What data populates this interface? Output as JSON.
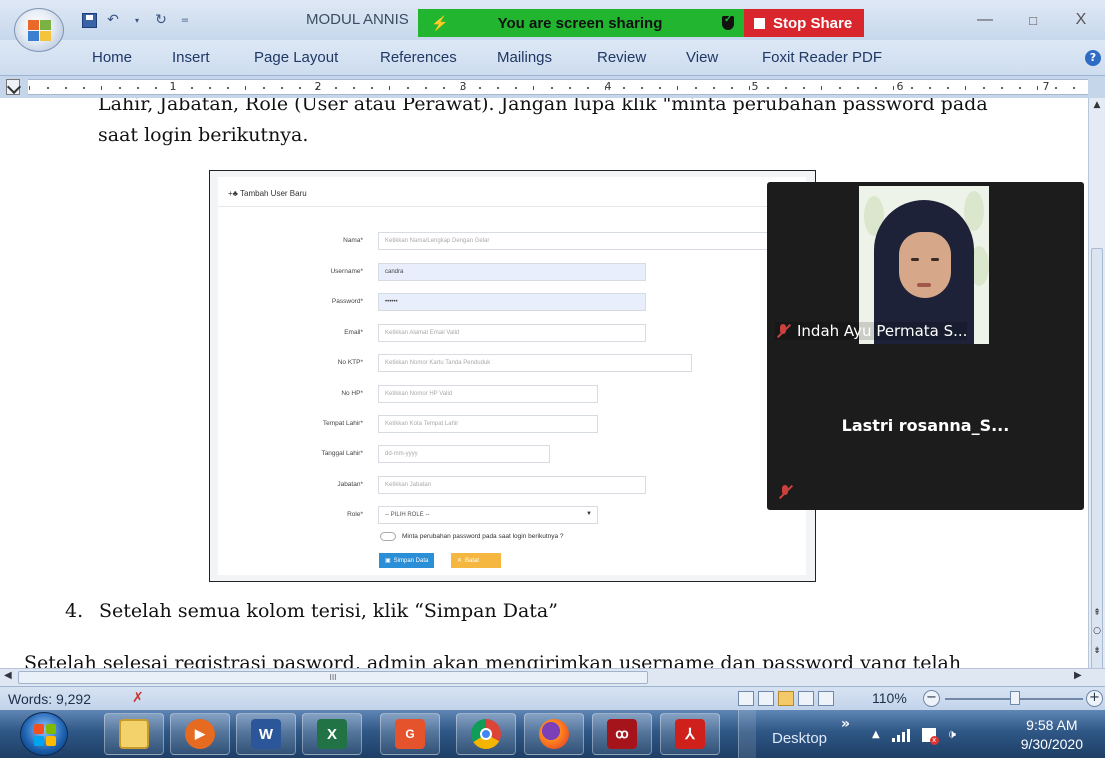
{
  "window": {
    "doc_title": "MODUL ANNIS",
    "min_symbol": "—",
    "max_symbol": "□",
    "close_symbol": "X"
  },
  "share": {
    "banner_text": "You are screen sharing",
    "stop_label": "Stop Share",
    "banner_color": "#22b630",
    "stop_color": "#d8262c"
  },
  "ribbon": {
    "tabs": [
      "Home",
      "Insert",
      "Page Layout",
      "References",
      "Mailings",
      "Review",
      "View",
      "Foxit Reader PDF"
    ]
  },
  "ruler": {
    "labels": [
      "1",
      "2",
      "3",
      "4",
      "5",
      "6",
      "7"
    ]
  },
  "document": {
    "line_top": "Lahir, Jabatan, Role (User atau Perawat). Jangan lupa klik \"minta perubahan password pada",
    "line_2": "saat login berikutnya.",
    "step_number": "4.",
    "step_text": "Setelah semua kolom terisi, klik “Simpan Data”",
    "line_bottom": "Setelah selesai registrasi pasword, admin akan mengirimkan username dan password yang telah"
  },
  "form_screenshot": {
    "header": "+♣ Tambah User Baru",
    "fields": [
      {
        "label": "Nama*",
        "value": "Ketikkan Nama/Lengkap Dengan Gelar",
        "filled": false
      },
      {
        "label": "Username*",
        "value": "candra",
        "filled": true
      },
      {
        "label": "Password*",
        "value": "••••••",
        "filled": true
      },
      {
        "label": "Email*",
        "value": "Ketikkan Alamat Email Valid",
        "filled": false
      },
      {
        "label": "No KTP*",
        "value": "Ketikkan Nomor Kartu Tanda Penduduk",
        "filled": false
      },
      {
        "label": "No HP*",
        "value": "Ketikkan Nomor HP Valid",
        "filled": false
      },
      {
        "label": "Tempat Lahir*",
        "value": "Ketikkan Kota Tempat Lahir",
        "filled": false
      },
      {
        "label": "Tanggal Lahir*",
        "value": "dd-mm-yyyy",
        "filled": false
      },
      {
        "label": "Jabatan*",
        "value": "Ketikkan Jabatan",
        "filled": false
      },
      {
        "label": "Role*",
        "value": "-- PILIH ROLE --",
        "filled": false
      }
    ],
    "checkbox_label": "Minta perubahan password pada saat login berikutnya ?",
    "save_label": "Simpan Data",
    "cancel_label": "Batal",
    "save_color": "#2a8fd6",
    "cancel_color": "#f5b740"
  },
  "video": {
    "participant_1": "Indah Ayu Permata S...",
    "participant_2": "Lastri  rosanna_S..."
  },
  "hscroll": {
    "grip": "III"
  },
  "status": {
    "words": "Words: 9,292",
    "zoom": "110%",
    "zoom_out": "−",
    "zoom_in": "+"
  },
  "taskbar": {
    "desktop_label": "Desktop",
    "desktop_chevron": "»",
    "time": "9:58 AM",
    "date": "9/30/2020",
    "tray_up": "▲",
    "volume": "🕩"
  }
}
